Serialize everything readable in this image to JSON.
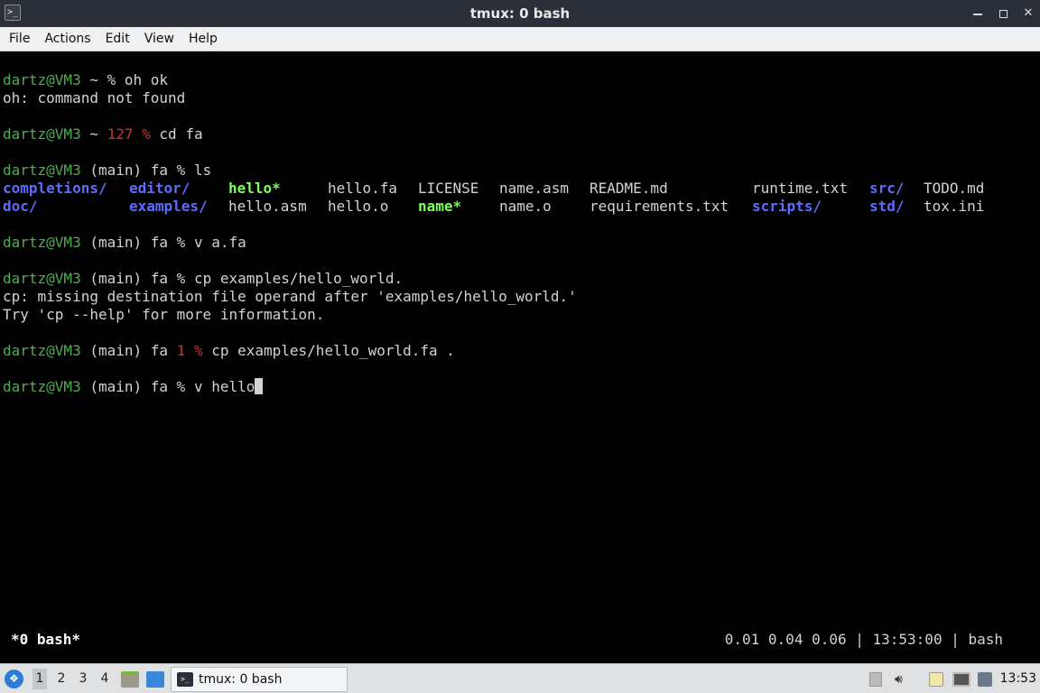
{
  "window": {
    "title": "tmux: 0 bash",
    "app_icon_glyph": ">_"
  },
  "menubar": {
    "items": [
      "File",
      "Actions",
      "Edit",
      "View",
      "Help"
    ]
  },
  "terminal": {
    "lines": [
      {
        "prompt_user": "dartz@VM3",
        "prompt_rest": " ~ % ",
        "command": "oh ok"
      },
      {
        "text": "oh: command not found"
      },
      {
        "prompt_user": "dartz@VM3",
        "prompt_rest": " ~ ",
        "exit_code": "127 %",
        "command": " cd fa"
      },
      {
        "prompt_user": "dartz@VM3",
        "prompt_rest": " (main) fa % ",
        "command": "ls"
      },
      {
        "text": "cp: missing destination file operand after 'examples/hello_world.'"
      },
      {
        "text": "Try 'cp --help' for more information."
      }
    ],
    "ls_row1": [
      "completions/",
      "editor/",
      "hello*",
      "hello.fa",
      "LICENSE",
      "name.asm",
      "README.md",
      "runtime.txt",
      "src/",
      "TODO.md"
    ],
    "ls_row2": [
      "doc/",
      "examples/",
      "hello.asm",
      "hello.o",
      "name*",
      "name.o",
      "requirements.txt",
      "scripts/",
      "std/",
      "tox.ini"
    ],
    "cmd_v_afa": "v a.fa",
    "cmd_cp1": "cp examples/hello_world.",
    "cmd_cp2_exit": "1 %",
    "cmd_cp2": " cp examples/hello_world.fa .",
    "cmd_current": "v hello",
    "prompt_user": "dartz@VM3",
    "prompt_main": " (main) fa % ",
    "prompt_main_noperc": " (main) fa "
  },
  "tmux": {
    "window_label": "*0 bash*",
    "status_right": "0.01 0.04 0.06 | 13:53:00 | bash"
  },
  "taskbar": {
    "workspaces": [
      "1",
      "2",
      "3",
      "4"
    ],
    "active_workspace": "1",
    "task_label": "tmux: 0 bash",
    "clock": "13:53"
  }
}
